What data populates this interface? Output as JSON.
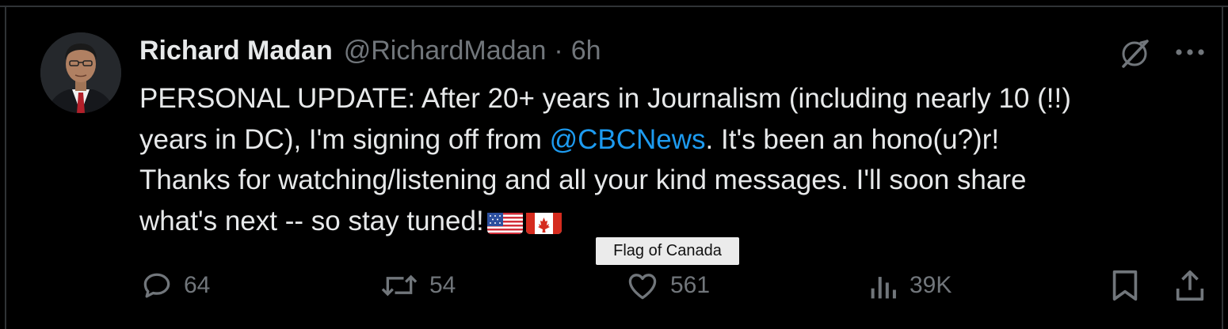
{
  "tweet": {
    "author_name": "Richard Madan",
    "handle": "@RichardMadan",
    "separator": "·",
    "time": "6h",
    "text": {
      "line1": "PERSONAL UPDATE: After 20+ years in Journalism (including nearly 10 (!!)",
      "line2_start": "years in DC), I'm signing off from ",
      "mention": "@CBCNews",
      "line2_end": ". It's been an hono(u?)r!",
      "line3": "Thanks for watching/listening and all your kind messages. I'll soon share",
      "line4": "what's next -- so stay tuned!"
    },
    "emojis": [
      "flag-united-states",
      "flag-canada"
    ],
    "tooltip": "Flag of Canada"
  },
  "actions": {
    "replies": "64",
    "reposts": "54",
    "likes": "561",
    "views": "39K"
  },
  "icons": [
    "grok-icon",
    "more-icon",
    "reply-icon",
    "repost-icon",
    "like-icon",
    "views-icon",
    "bookmark-icon",
    "share-icon"
  ],
  "colors": {
    "background": "#000000",
    "text": "#e7e9ea",
    "secondary": "#71767b",
    "mention": "#1d9bf0",
    "border": "#2f3336"
  }
}
